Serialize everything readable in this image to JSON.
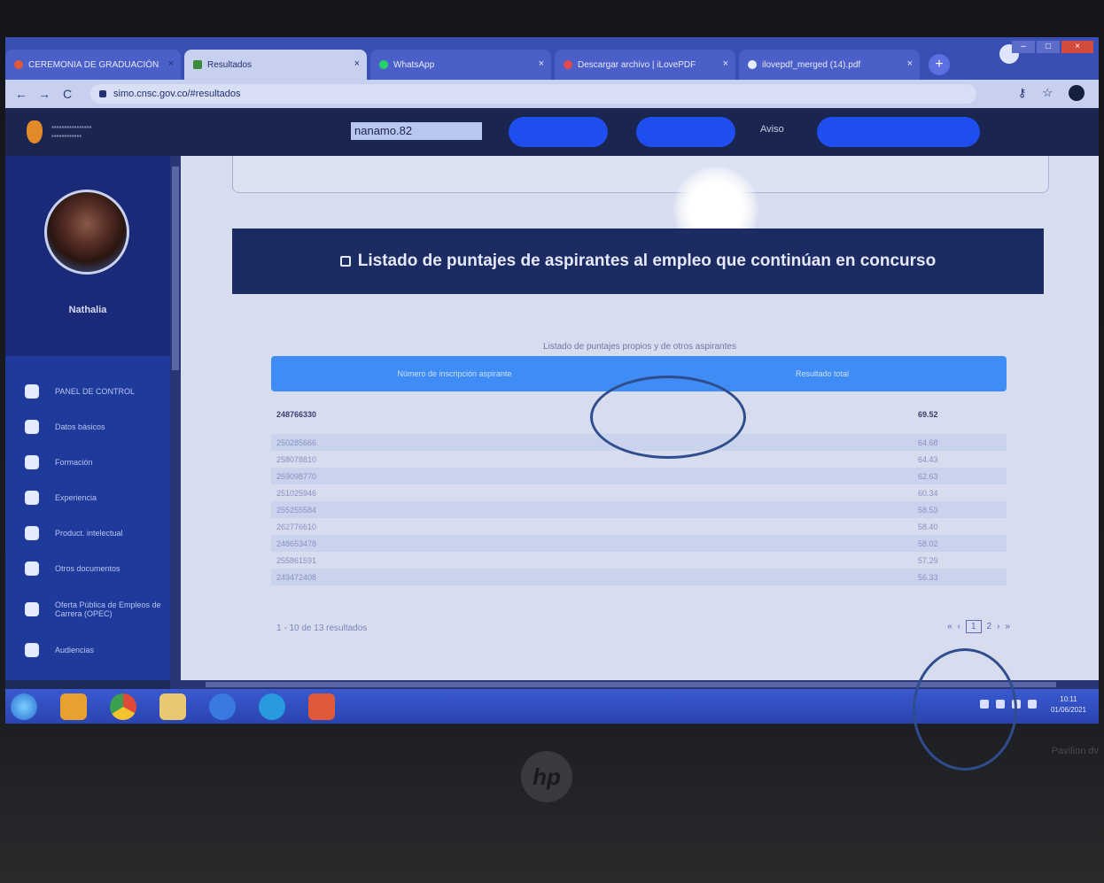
{
  "browser": {
    "tabs": [
      {
        "title": "CEREMONIA DE GRADUACIÓN",
        "icon": "document-icon",
        "active": false
      },
      {
        "title": "Resultados",
        "icon": "folder-icon",
        "active": true
      },
      {
        "title": "WhatsApp",
        "icon": "whatsapp-icon",
        "active": false
      },
      {
        "title": "Descargar archivo | iLovePDF",
        "icon": "pdf-icon",
        "active": false
      },
      {
        "title": "ilovepdf_merged (14).pdf",
        "icon": "globe-icon",
        "active": false
      }
    ],
    "url": "simo.cnsc.gov.co/#resultados"
  },
  "header": {
    "username_field": "nanamo.82",
    "aviso_link": "Aviso"
  },
  "sidebar": {
    "user_name": "Nathalia",
    "items": [
      {
        "label": "PANEL DE CONTROL",
        "icon": "dashboard-icon"
      },
      {
        "label": "Datos básicos",
        "icon": "user-icon"
      },
      {
        "label": "Formación",
        "icon": "graduation-icon"
      },
      {
        "label": "Experiencia",
        "icon": "briefcase-icon"
      },
      {
        "label": "Product. intelectual",
        "icon": "book-icon"
      },
      {
        "label": "Otros documentos",
        "icon": "file-icon"
      },
      {
        "label": "Oferta Pública de Empleos de Carrera (OPEC)",
        "icon": "globe-icon"
      },
      {
        "label": "Audiencias",
        "icon": "people-icon"
      }
    ]
  },
  "main": {
    "banner_title": "Listado de puntajes de aspirantes al empleo que continúan en concurso",
    "table_caption": "Listado de puntajes propios y de otros aspirantes",
    "columns": [
      "Número de inscripción aspirante",
      "Resultado total"
    ],
    "rows": [
      {
        "id": "248766330",
        "score": "69.52"
      },
      {
        "id": "250285666",
        "score": "64.68"
      },
      {
        "id": "258078810",
        "score": "64.43"
      },
      {
        "id": "259098770",
        "score": "62.63"
      },
      {
        "id": "251025946",
        "score": "60.34"
      },
      {
        "id": "255255584",
        "score": "58.53"
      },
      {
        "id": "262776610",
        "score": "58.40"
      },
      {
        "id": "248653478",
        "score": "58.02"
      },
      {
        "id": "255861591",
        "score": "57.29"
      },
      {
        "id": "249472408",
        "score": "56.33"
      }
    ],
    "results_count": "1 - 10 de 13 resultados",
    "pager": {
      "first": "«",
      "prev": "‹",
      "current": "1",
      "next_page": "2",
      "next": "›",
      "last": "»"
    }
  },
  "taskbar": {
    "time": "10:11",
    "date": "01/06/2021"
  },
  "laptop": {
    "logo": "hp",
    "corner_text": "Pavilion dv"
  },
  "colors": {
    "header_bg": "#1a2550",
    "sidebar_bg": "#1e3a9a",
    "banner_bg": "#1c2b62",
    "table_header": "#3f8cf5",
    "primary_button": "#1e4ef0",
    "annotation_ring": "#2f4d8c"
  }
}
